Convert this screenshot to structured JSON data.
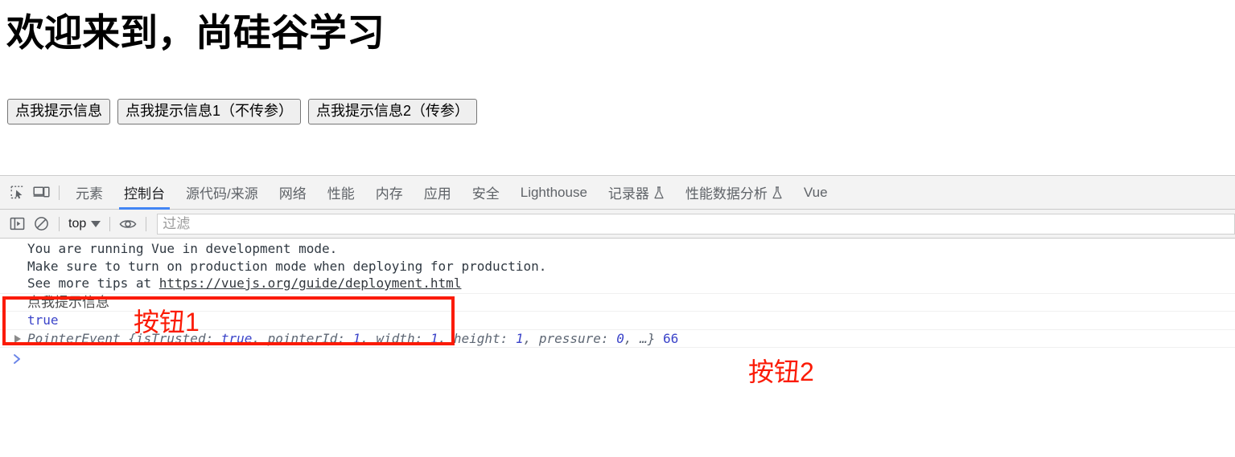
{
  "page": {
    "heading": "欢迎来到，尚硅谷学习",
    "buttons": [
      {
        "name": "hint-plain",
        "label": "点我提示信息"
      },
      {
        "name": "hint-1-noargs",
        "label": "点我提示信息1（不传参）"
      },
      {
        "name": "hint-2-args",
        "label": "点我提示信息2（传参）"
      }
    ]
  },
  "devtools": {
    "icons": {
      "inspect": "inspect-element-icon",
      "device": "device-toolbar-icon",
      "sidebar": "console-sidebar-icon",
      "clear": "clear-console-icon",
      "eye": "live-expression-eye-icon",
      "flask": "experimental-flask-icon"
    },
    "tabs": [
      {
        "label": "元素",
        "active": false,
        "flask": false
      },
      {
        "label": "控制台",
        "active": true,
        "flask": false
      },
      {
        "label": "源代码/来源",
        "active": false,
        "flask": false
      },
      {
        "label": "网络",
        "active": false,
        "flask": false
      },
      {
        "label": "性能",
        "active": false,
        "flask": false
      },
      {
        "label": "内存",
        "active": false,
        "flask": false
      },
      {
        "label": "应用",
        "active": false,
        "flask": false
      },
      {
        "label": "安全",
        "active": false,
        "flask": false
      },
      {
        "label": "Lighthouse",
        "active": false,
        "flask": false
      },
      {
        "label": "记录器",
        "active": false,
        "flask": true
      },
      {
        "label": "性能数据分析",
        "active": false,
        "flask": true
      },
      {
        "label": "Vue",
        "active": false,
        "flask": false
      }
    ],
    "toolbar": {
      "context_label": "top",
      "filter_placeholder": "过滤"
    },
    "console": {
      "vue_warning": {
        "line1": "You are running Vue in development mode.",
        "line2": "Make sure to turn on production mode when deploying for production.",
        "line3_prefix": "See more tips at ",
        "line3_link": "https://vuejs.org/guide/deployment.html"
      },
      "log_chinese": "点我提示信息",
      "log_boolean": "true",
      "pointer_event": {
        "class_name": "PointerEvent",
        "open_brace": "{",
        "props": [
          {
            "key": "isTrusted:",
            "value": "true"
          },
          {
            "key": "pointerId:",
            "value": "1"
          },
          {
            "key": "width:",
            "value": "1"
          },
          {
            "key": "height:",
            "value": "1"
          },
          {
            "key": "pressure:",
            "value": "0"
          }
        ],
        "ellipsis": "…}",
        "trailing_number": "66"
      },
      "prompt_caret": "❯"
    }
  },
  "annotations": {
    "label1": "按钮1",
    "label2": "按钮2",
    "box_color": "#fb1b06"
  }
}
